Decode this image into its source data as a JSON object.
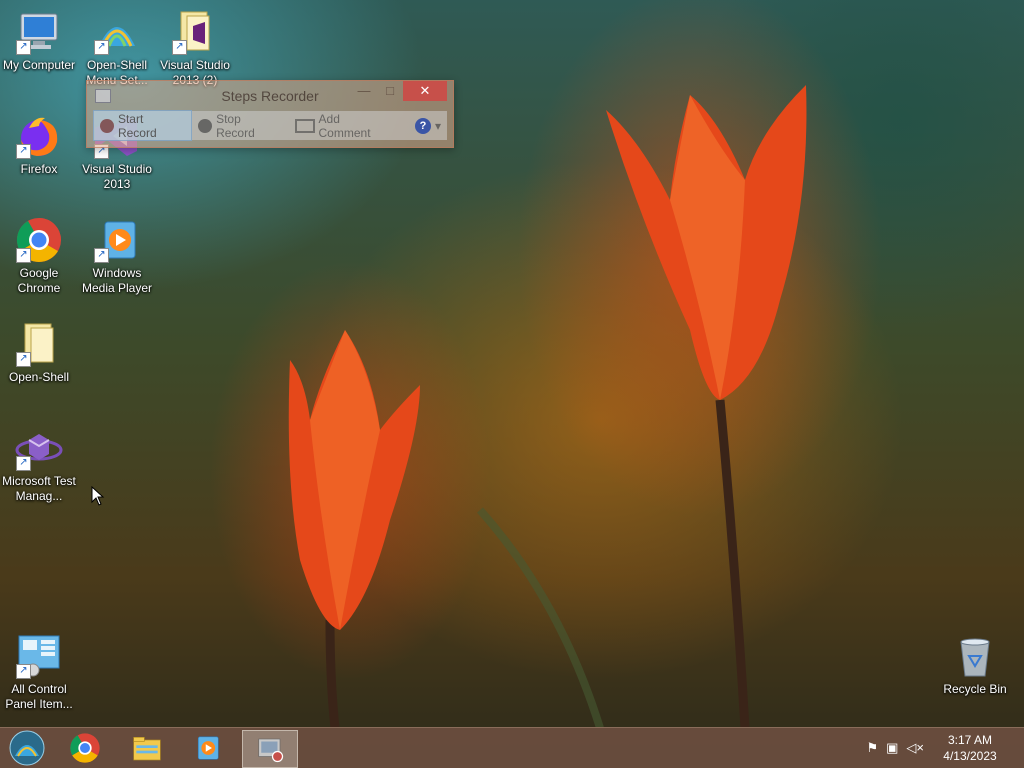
{
  "desktop": {
    "icons": [
      {
        "label": "My Computer",
        "icon": "computer-icon"
      },
      {
        "label": "Open-Shell Menu Set...",
        "icon": "shell-icon"
      },
      {
        "label": "Visual Studio 2013 (2)",
        "icon": "folder-icon"
      },
      {
        "label": "Firefox",
        "icon": "firefox-icon"
      },
      {
        "label": "Visual Studio 2013",
        "icon": "visual-studio-icon"
      },
      {
        "label": "Google Chrome",
        "icon": "chrome-icon"
      },
      {
        "label": "Windows Media Player",
        "icon": "media-player-icon"
      },
      {
        "label": "Open-Shell",
        "icon": "folder-icon"
      },
      {
        "label": "Microsoft Test Manag...",
        "icon": "test-manager-icon"
      },
      {
        "label": "All Control Panel Item...",
        "icon": "control-panel-icon"
      },
      {
        "label": "Recycle Bin",
        "icon": "recycle-bin-icon"
      }
    ]
  },
  "steps_recorder": {
    "title": "Steps Recorder",
    "minimize": "—",
    "maximize": "□",
    "close": "✕",
    "start_record": "Start Record",
    "stop_record": "Stop Record",
    "add_comment": "Add Comment",
    "help": "?",
    "dropdown": "▾"
  },
  "taskbar": {
    "items": [
      "start-orb",
      "chrome",
      "file-explorer",
      "media-player",
      "steps-recorder"
    ],
    "clock_time": "3:17 AM",
    "clock_date": "4/13/2023"
  },
  "colors": {
    "taskbar": "#6e5041",
    "close_button": "#c7504a",
    "tulip": "#e8501a"
  }
}
